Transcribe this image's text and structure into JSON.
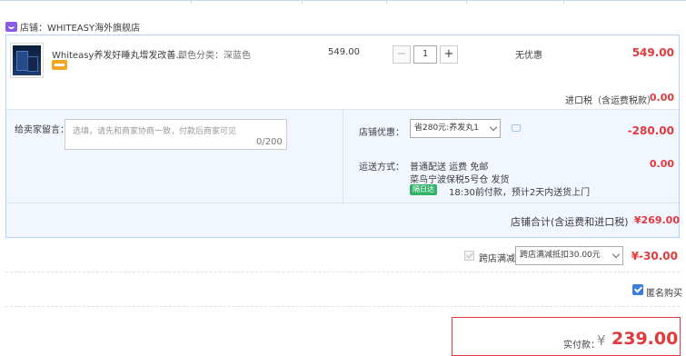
{
  "shop": {
    "label": "店铺：WHITEASY海外旗舰店"
  },
  "product": {
    "title": "Whiteasy养发好睡丸增发改善...",
    "attribute": "颜色分类：深蓝色",
    "unit_price": "549.00",
    "quantity": "1",
    "discount_text": "无优惠",
    "subtotal": "549.00",
    "qty_minus": "−",
    "qty_plus": "+"
  },
  "tax": {
    "label": "进口税（含运费税款）",
    "value": "0.00"
  },
  "message": {
    "label": "给卖家留言：",
    "placeholder": "选填，请先和商家协商一致，付款后商家可见",
    "count": "0/200"
  },
  "shop_discount": {
    "label": "店铺优惠：",
    "selected": "省280元:养发丸1",
    "value": "-280.00"
  },
  "shipping": {
    "label": "运送方式：",
    "line1": "普通配送 运费 免邮",
    "line2": "菜鸟宁波保税5号仓   发货",
    "badge": "隔日达",
    "line3": "18:30前付款，预计2天内送货上门",
    "value": "0.00"
  },
  "shop_total": {
    "label": "店铺合计(含运费和进口税)",
    "value": "¥269.00"
  },
  "cross_store": {
    "label": "跨店满减",
    "selected": "跨店满减抵扣30.00元",
    "value": "¥-30.00"
  },
  "anonymous": {
    "label": "匿名购买"
  },
  "payment": {
    "label": "实付款：",
    "currency": "¥",
    "value": "239.00"
  },
  "colors": {
    "accent": "#e4393c",
    "border": "#b2d1ff",
    "panel": "#f2f7ff"
  }
}
